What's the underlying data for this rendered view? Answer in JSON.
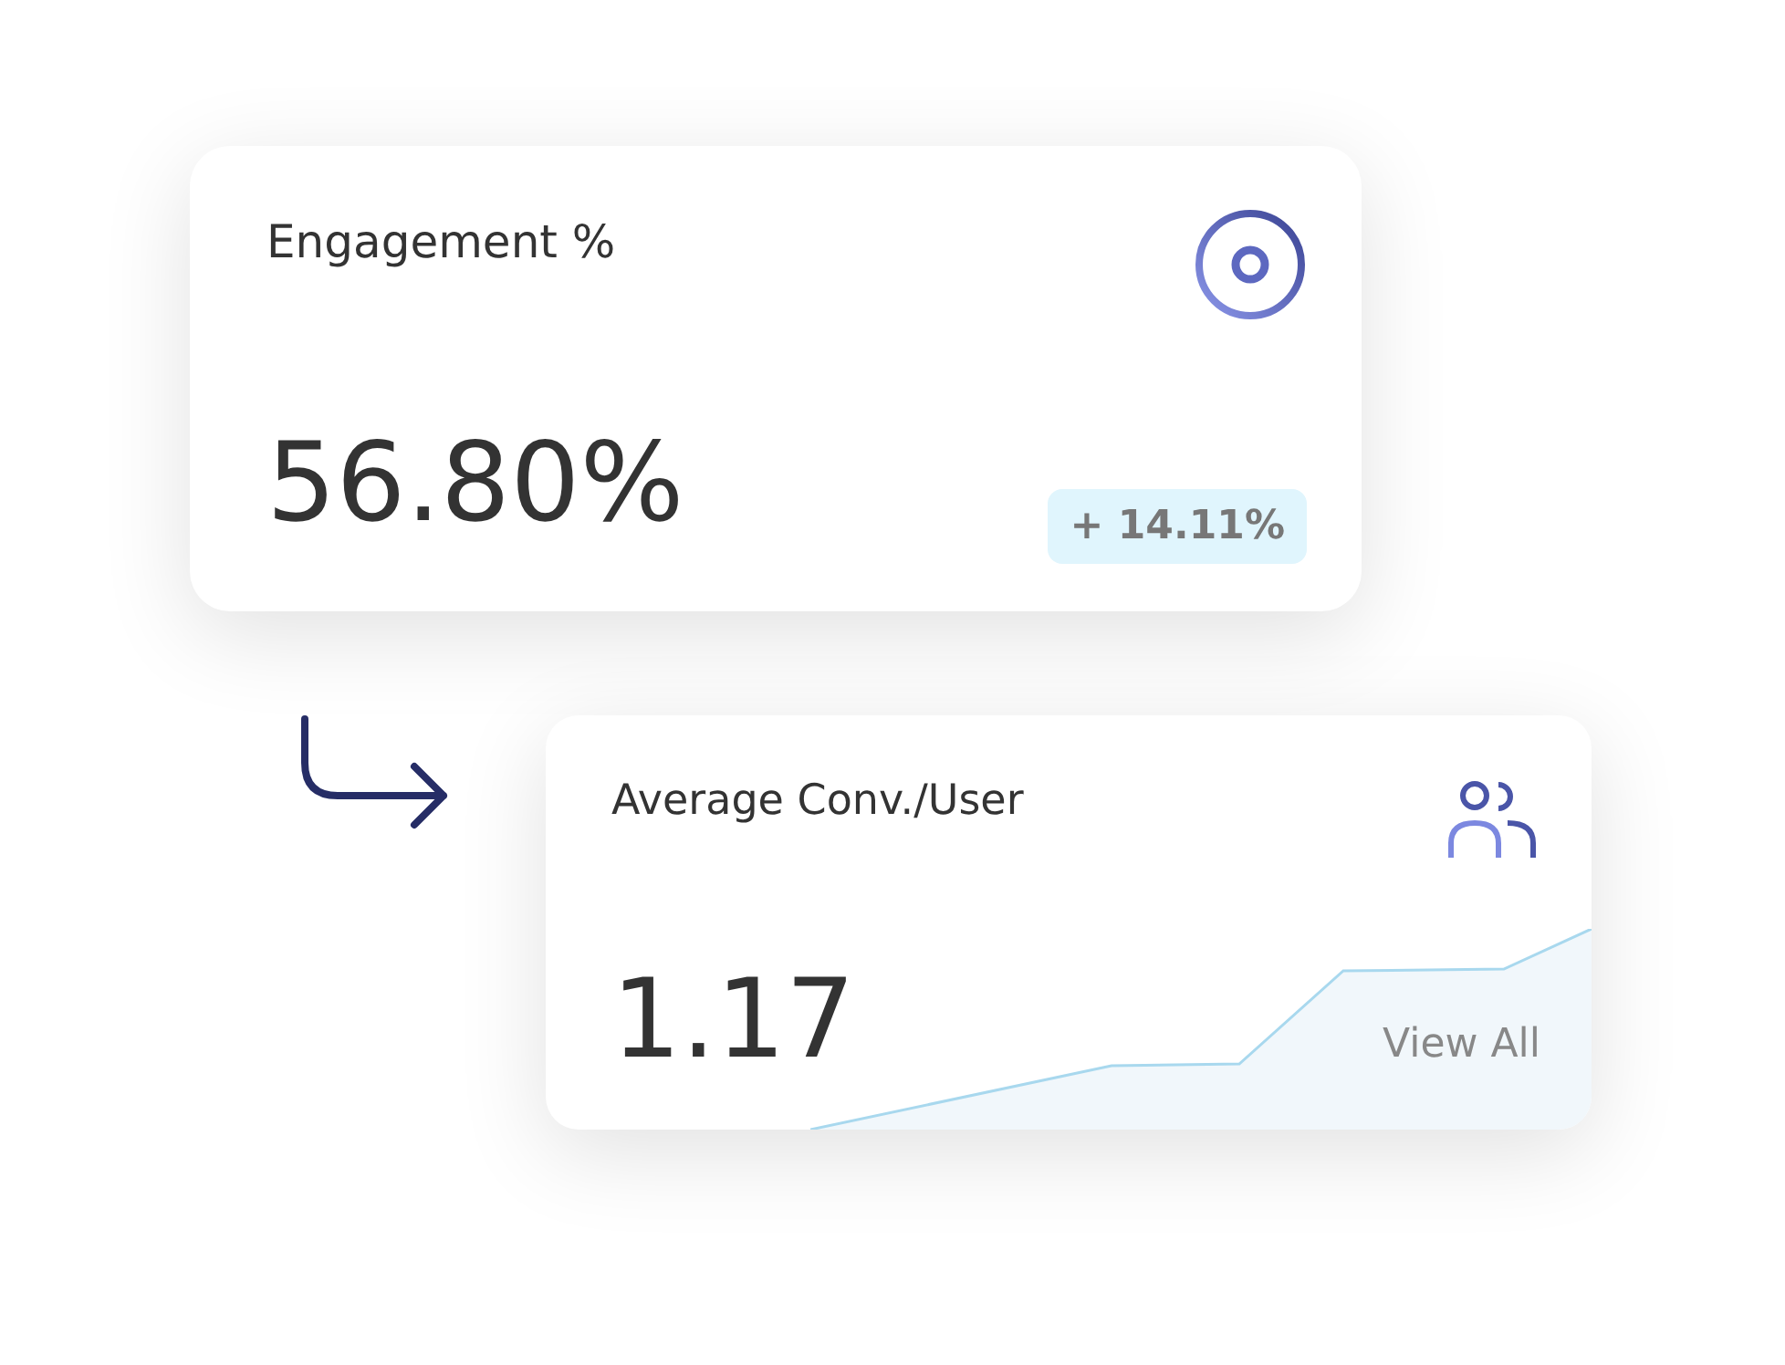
{
  "engagement_card": {
    "title": "Engagement %",
    "value": "56.80%",
    "change": "+ 14.11%"
  },
  "conversion_card": {
    "title": "Average Conv./User",
    "value": "1.17",
    "link": "View All"
  }
}
